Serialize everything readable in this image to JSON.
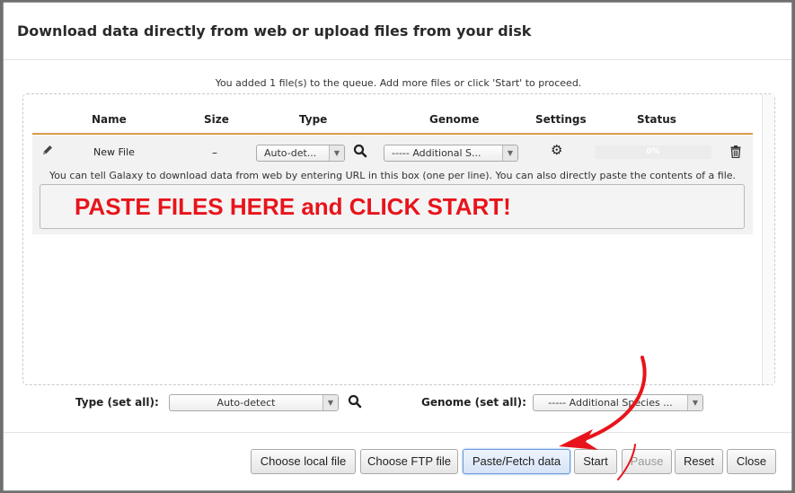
{
  "dialog": {
    "title": "Download data directly from web or upload files from your disk",
    "queue_message": "You added 1 file(s) to the queue. Add more files or click 'Start' to proceed."
  },
  "table": {
    "headers": {
      "name": "Name",
      "size": "Size",
      "type": "Type",
      "genome": "Genome",
      "settings": "Settings",
      "status": "Status"
    },
    "rows": [
      {
        "name": "New File",
        "size": "–",
        "type": "Auto-det...",
        "genome": "----- Additional S...",
        "status_progress": "0%",
        "hint": "You can tell Galaxy to download data from web by entering URL in this box (one per line). You can also directly paste the contents of a file.",
        "paste_content": "PASTE FILES HERE and CLICK START!"
      }
    ]
  },
  "set_all": {
    "type_label": "Type (set all):",
    "type_value": "Auto-detect",
    "genome_label": "Genome (set all):",
    "genome_value": "----- Additional Species ..."
  },
  "footer": {
    "choose_local": "Choose local file",
    "choose_ftp": "Choose FTP file",
    "paste_fetch": "Paste/Fetch data",
    "start": "Start",
    "pause": "Pause",
    "reset": "Reset",
    "close": "Close"
  },
  "colors": {
    "annotation": "#e8141b",
    "header_rule": "#d79a4a",
    "primary_button": "#6d9ad9"
  },
  "icons": [
    "pencil-icon",
    "search-icon",
    "gear-icon",
    "trash-icon",
    "arrow-annotation"
  ]
}
